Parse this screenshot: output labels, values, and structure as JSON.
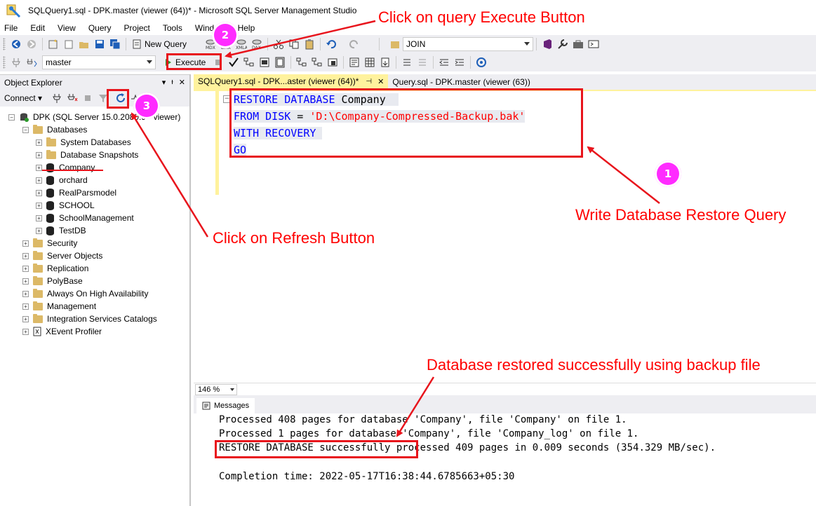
{
  "window": {
    "title": "SQLQuery1.sql - DPK.master (viewer (64))* - Microsoft SQL Server Management Studio"
  },
  "menu": [
    "File",
    "Edit",
    "View",
    "Query",
    "Project",
    "Tools",
    "Window",
    "Help"
  ],
  "toolbar": {
    "new_query": "New Query",
    "search_combo": "JOIN",
    "database_combo": "master",
    "execute": "Execute"
  },
  "object_explorer": {
    "title": "Object Explorer",
    "connect": "Connect",
    "server": "DPK (SQL Server 15.0.2080.9 - viewer)",
    "databases_label": "Databases",
    "database_items": [
      "System Databases",
      "Database Snapshots",
      "Company",
      "orchard",
      "RealParsmodel",
      "SCHOOL",
      "SchoolManagement",
      "TestDB"
    ],
    "server_folders": [
      "Security",
      "Server Objects",
      "Replication",
      "PolyBase",
      "Always On High Availability",
      "Management",
      "Integration Services Catalogs",
      "XEvent Profiler"
    ]
  },
  "tabs": {
    "active": "SQLQuery1.sql - DPK...aster (viewer (64))*",
    "second": "Query.sql - DPK.master (viewer (63))"
  },
  "query": {
    "line1_kw": "RESTORE DATABASE",
    "line1_name": " Company",
    "line2_kw": "FROM DISK",
    "line2_eq": " = ",
    "line2_str": "'D:\\Company-Compressed-Backup.bak'",
    "line3": "WITH RECOVERY",
    "line4": "GO"
  },
  "zoom": "146 %",
  "messages": {
    "tab": "Messages",
    "line1": "Processed 408 pages for database 'Company', file 'Company' on file 1.",
    "line2": "Processed 1 pages for database 'Company', file 'Company_log' on file 1.",
    "line3_highlight": "RESTORE DATABASE successfully",
    "line3_rest": " processed 409 pages in 0.009 seconds (354.329 MB/sec).",
    "completion": "Completion time: 2022-05-17T16:38:44.6785663+05:30"
  },
  "annotations": {
    "execute_note": "Click on query Execute Button",
    "write_note": "Write Database Restore Query",
    "refresh_note": "Click on Refresh Button",
    "success_note": "Database restored successfully using backup file",
    "badge1": "1",
    "badge2": "2",
    "badge3": "3"
  },
  "colors": {
    "annotation": "#ff0000",
    "badge": "#ff2bff",
    "keyword": "#0000ff",
    "string": "#ff0000",
    "tab_active": "#fff29d"
  }
}
